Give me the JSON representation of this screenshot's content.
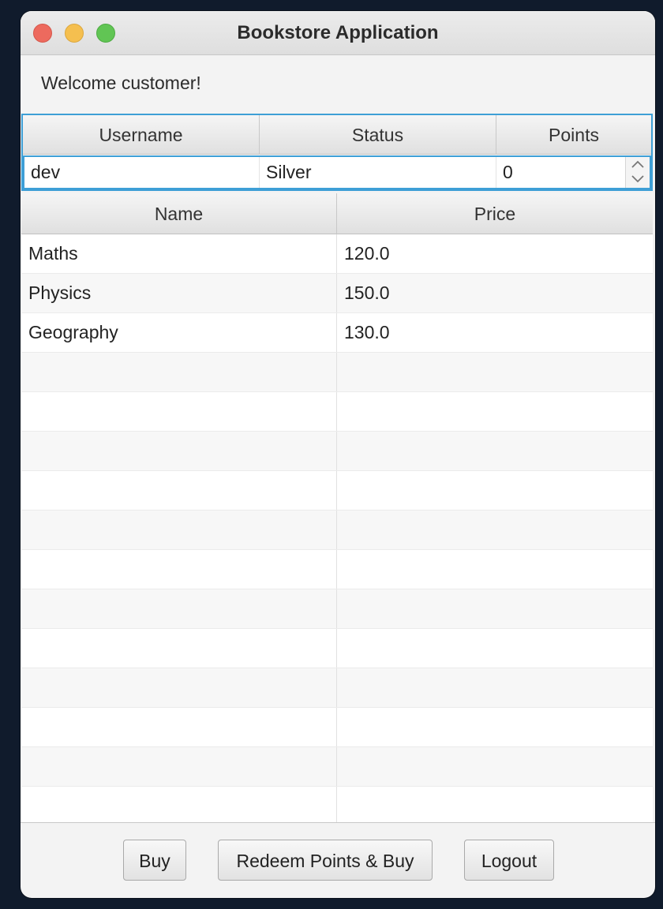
{
  "window": {
    "title": "Bookstore Application"
  },
  "welcome_text": "Welcome customer!",
  "user_table": {
    "columns": [
      "Username",
      "Status",
      "Points"
    ],
    "row": {
      "username": "dev",
      "status": "Silver",
      "points": "0"
    }
  },
  "books_table": {
    "columns": [
      "Name",
      "Price"
    ],
    "rows": [
      {
        "name": "Maths",
        "price": "120.0"
      },
      {
        "name": "Physics",
        "price": "150.0"
      },
      {
        "name": "Geography",
        "price": "130.0"
      }
    ]
  },
  "buttons": {
    "buy": "Buy",
    "redeem": "Redeem Points & Buy",
    "logout": "Logout"
  },
  "icons": {
    "spinner_up": "chevron-up-icon",
    "spinner_down": "chevron-down-icon"
  },
  "colors": {
    "desktop_background": "#101b2c",
    "focus_border": "#3e9fd6",
    "close": "#ed6a5e",
    "minimize": "#f5bf4f",
    "maximize": "#61c554"
  }
}
